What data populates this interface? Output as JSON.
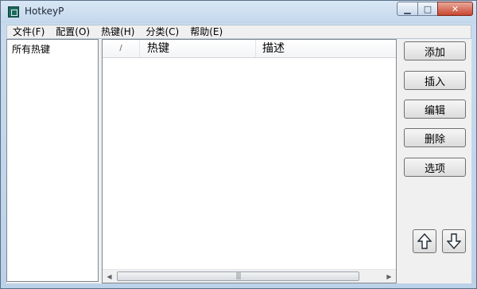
{
  "window": {
    "title": "HotkeyP",
    "controls": {
      "minimize": "▁",
      "maximize": "□",
      "close": "✕"
    }
  },
  "menu": [
    {
      "label": "文件(F)"
    },
    {
      "label": "配置(O)"
    },
    {
      "label": "热键(H)"
    },
    {
      "label": "分类(C)"
    },
    {
      "label": "帮助(E)"
    }
  ],
  "tree": {
    "items": [
      {
        "label": "所有热键"
      }
    ]
  },
  "list": {
    "columns": [
      {
        "label": "/"
      },
      {
        "label": "热键"
      },
      {
        "label": "描述"
      }
    ],
    "rows": [],
    "scrollbar": {
      "left_arrow": "◀",
      "right_arrow": "▶",
      "grip": "|||"
    }
  },
  "actions": {
    "add": "添加",
    "insert": "插入",
    "edit": "编辑",
    "delete": "删除",
    "options": "选项",
    "move_up_icon": "up-arrow-icon",
    "move_down_icon": "down-arrow-icon"
  },
  "colors": {
    "window_frame": "#bcd2e8",
    "client_bg": "#f0f0f0",
    "close_button": "#c9462f",
    "app_icon": "#1d6b5f"
  }
}
